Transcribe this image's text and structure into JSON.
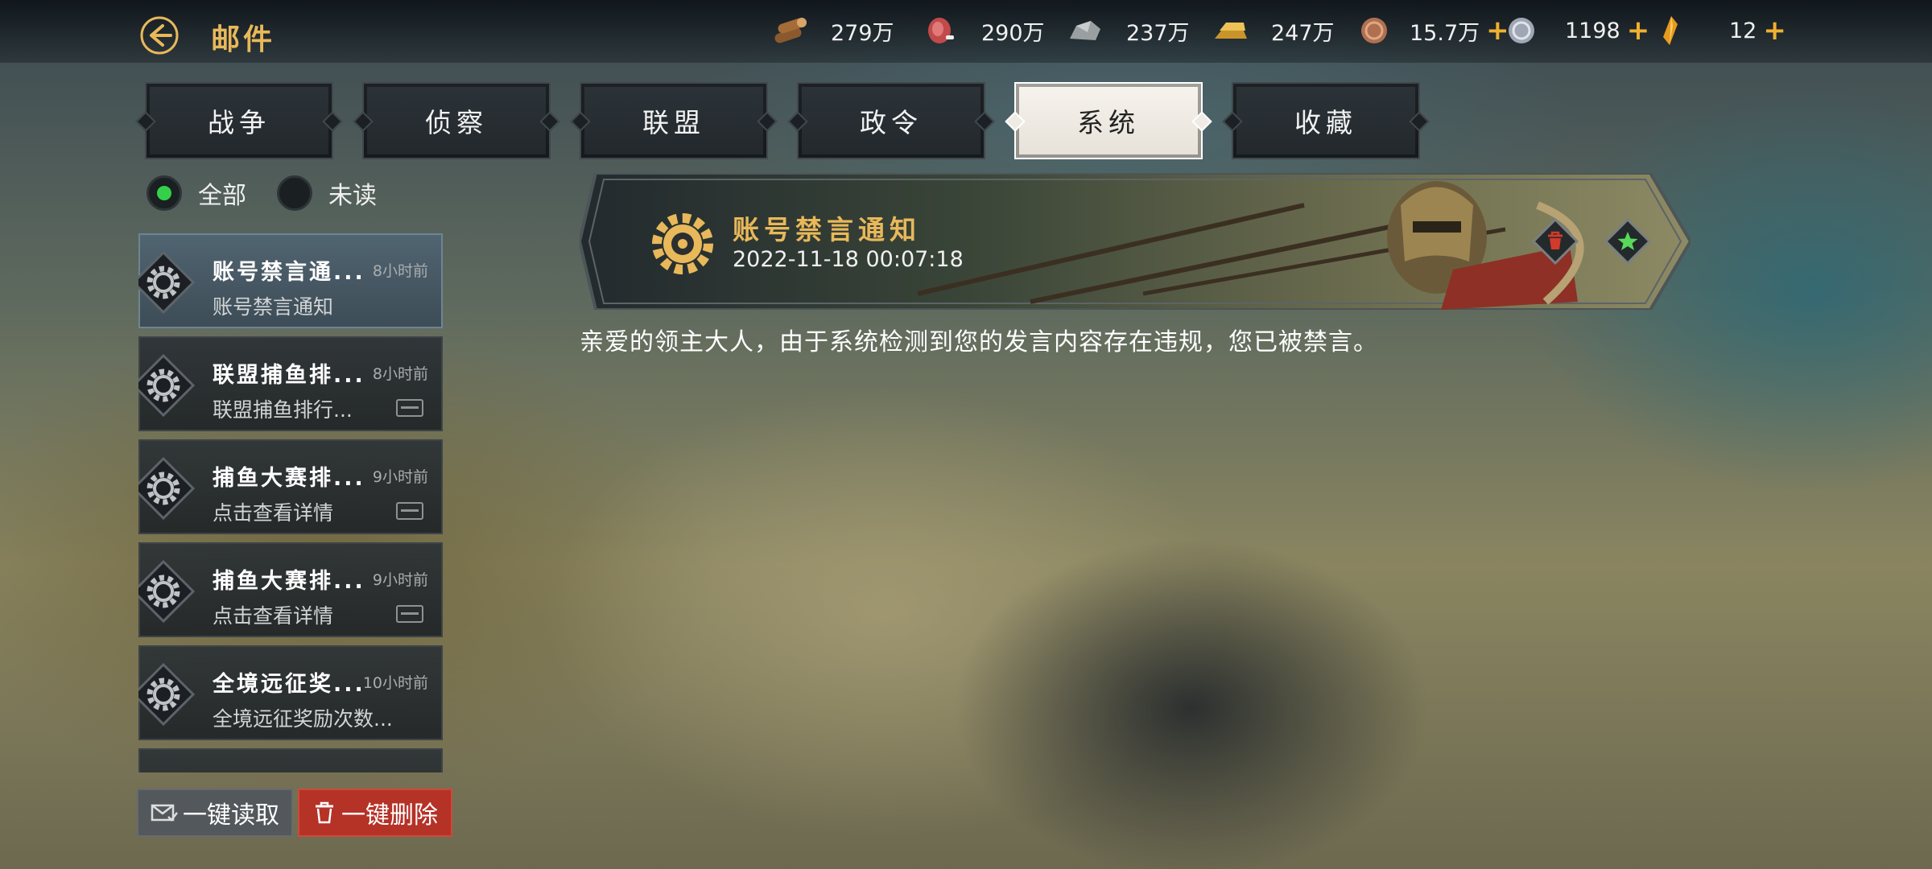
{
  "page": {
    "title": "邮件"
  },
  "resources": [
    {
      "icon": "wood-icon",
      "value": "279万",
      "has_plus": false
    },
    {
      "icon": "meat-icon",
      "value": "290万",
      "has_plus": false
    },
    {
      "icon": "stone-icon",
      "value": "237万",
      "has_plus": false
    },
    {
      "icon": "gold-bar-icon",
      "value": "247万",
      "has_plus": false
    },
    {
      "icon": "copper-coin-icon",
      "value": "15.7万",
      "has_plus": true
    },
    {
      "icon": "silver-coin-icon",
      "value": "1198",
      "has_plus": true
    },
    {
      "icon": "amber-gem-icon",
      "value": "12",
      "has_plus": true
    }
  ],
  "plus_symbol": "+",
  "tabs": [
    {
      "label": "战争",
      "active": false
    },
    {
      "label": "侦察",
      "active": false
    },
    {
      "label": "联盟",
      "active": false
    },
    {
      "label": "政令",
      "active": false
    },
    {
      "label": "系统",
      "active": true
    },
    {
      "label": "收藏",
      "active": false
    }
  ],
  "filters": [
    {
      "label": "全部",
      "selected": true
    },
    {
      "label": "未读",
      "selected": false
    }
  ],
  "mails": [
    {
      "title": "账号禁言通...",
      "time": "8小时前",
      "subtitle": "账号禁言通知",
      "attachment": false,
      "selected": true
    },
    {
      "title": "联盟捕鱼排...",
      "time": "8小时前",
      "subtitle": "联盟捕鱼排行...",
      "attachment": true,
      "selected": false
    },
    {
      "title": "捕鱼大赛排...",
      "time": "9小时前",
      "subtitle": "点击查看详情",
      "attachment": true,
      "selected": false
    },
    {
      "title": "捕鱼大赛排...",
      "time": "9小时前",
      "subtitle": "点击查看详情",
      "attachment": true,
      "selected": false
    },
    {
      "title": "全境远征奖...",
      "time": "10小时前",
      "subtitle": "全境远征奖励次数...",
      "attachment": false,
      "selected": false
    }
  ],
  "buttons": {
    "read_all": "一键读取",
    "delete_all": "一键删除"
  },
  "detail": {
    "title": "账号禁言通知",
    "date": "2022-11-18 00:07:18",
    "body": "亲爱的领主大人，由于系统检测到您的发言内容存在违规，您已被禁言。"
  },
  "colors": {
    "accent_gold": "#e8b85a",
    "delete_red": "#b53227",
    "radio_green": "#35d04a",
    "favorite_green": "#59d95a"
  }
}
